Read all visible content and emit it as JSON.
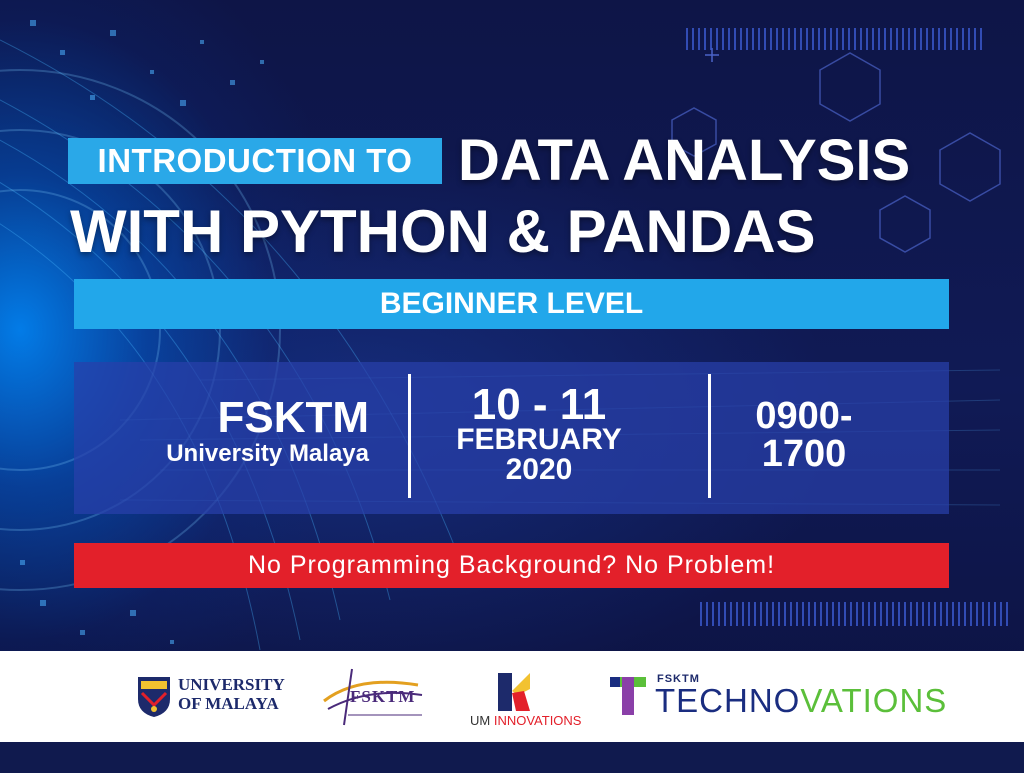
{
  "title": {
    "intro": "INTRODUCTION TO",
    "line1": "DATA ANALYSIS",
    "line2": "WITH PYTHON & PANDAS"
  },
  "level": "BEGINNER LEVEL",
  "venue": {
    "name": "FSKTM",
    "university": "University Malaya"
  },
  "date": {
    "days": "10 - 11",
    "month": "FEBRUARY",
    "year": "2020"
  },
  "time": {
    "start": "0900-",
    "end": "1700"
  },
  "tagline": "No Programming Background? No Problem!",
  "logos": {
    "um": [
      "UNIVERSITY",
      "OF MALAYA"
    ],
    "fsktm": "FSKTM",
    "umi_prefix": "UM ",
    "umi_accent": "INNOVATIONS",
    "techno_small": "FSKTM",
    "techno_part1": "TECHNO",
    "techno_part2": "VATIONS"
  },
  "colors": {
    "background": "#0e1547",
    "accent_blue": "#22a7ea",
    "accent_red": "#e3202a",
    "panel": "#2840aa",
    "techno_green": "#5bbf3a"
  }
}
